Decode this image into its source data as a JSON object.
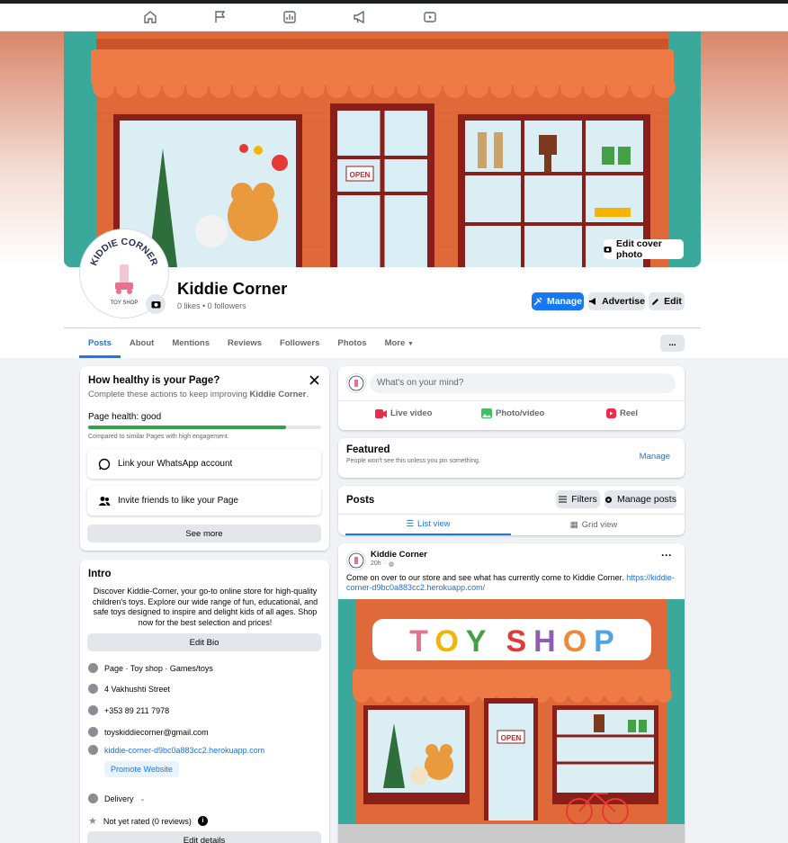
{
  "nav": {
    "items": [
      "home-icon",
      "flag-icon",
      "insights-icon",
      "megaphone-icon",
      "video-icon"
    ]
  },
  "cover": {
    "edit_cover_label": "Edit cover photo"
  },
  "page": {
    "name": "Kiddie Corner",
    "stats": "0 likes • 0 followers"
  },
  "avatar_logo": {
    "line1": "KIDDIE CORNER",
    "line2": "TOY SHOP"
  },
  "actions": {
    "manage": "Manage",
    "advertise": "Advertise",
    "edit": "Edit"
  },
  "tabs": {
    "posts": "Posts",
    "about": "About",
    "mentions": "Mentions",
    "reviews": "Reviews",
    "followers": "Followers",
    "photos": "Photos",
    "more": "More",
    "more_btn": "..."
  },
  "health": {
    "title": "How healthy is your Page?",
    "subtitle_pre": "Complete these actions to keep improving ",
    "subtitle_name": "Kiddie Corner",
    "subtitle_post": ".",
    "label": "Page health: good",
    "progress": 0.85,
    "compare": "Compared to similar Pages with high engagement.",
    "items": [
      "Link your WhatsApp account",
      "Invite friends to like your Page"
    ],
    "see_more": "See more"
  },
  "intro": {
    "title": "Intro",
    "bio": "Discover Kiddie-Corner, your go-to online store for high-quality children's toys. Explore our wide range of fun, educational, and safe toys designed to inspire and delight kids of all ages. Shop now for the best selection and prices!",
    "edit_bio": "Edit Bio",
    "category": "Page · Toy shop · Games/toys",
    "address": "4 Vakhushti Street",
    "phone": "+353 89 211 7978",
    "email": "toyskiddiecorner@gmail.com",
    "website": "kiddie-corner-d9bc0a883cc2.herokuapp.com",
    "promote": "Promote Website",
    "delivery": "Delivery",
    "rating": "Not yet rated (0 reviews)",
    "edit_details": "Edit details"
  },
  "composer": {
    "placeholder": "What's on your mind?",
    "live": "Live video",
    "photo": "Photo/video",
    "reel": "Reel"
  },
  "featured": {
    "title": "Featured",
    "subtitle": "People won't see this unless you pin something.",
    "manage": "Manage"
  },
  "posts_header": {
    "title": "Posts",
    "filters": "Filters",
    "manage_posts": "Manage posts",
    "list_view": "List view",
    "grid_view": "Grid view"
  },
  "post": {
    "author": "Kiddie Corner",
    "time": "20h",
    "text": "Come on over to our store and see what has currently come to Kiddie Corner.",
    "link": "https://kiddie-corner-d9bc0a883cc2.herokuapp.com/",
    "more": "···"
  },
  "shop_image": {
    "sign": [
      "T",
      "O",
      "Y",
      "S",
      "H",
      "O",
      "P"
    ],
    "open_sign": "OPEN"
  },
  "colors": {
    "accent": "#1877f2",
    "brick": "#e0693a",
    "teal": "#3aa89a",
    "health_bar": "#31a24c"
  }
}
